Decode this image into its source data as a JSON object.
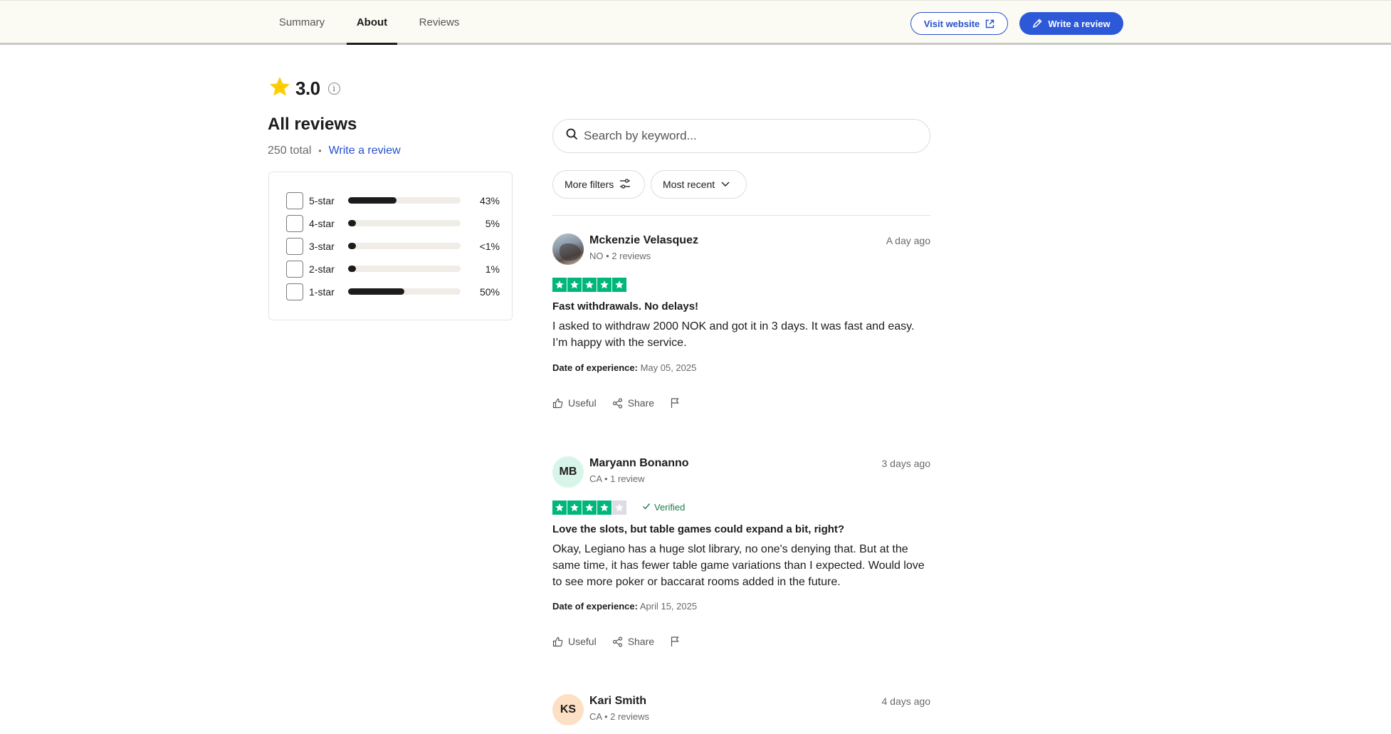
{
  "nav": {
    "tabs": [
      {
        "label": "Summary",
        "active": false
      },
      {
        "label": "About",
        "active": true
      },
      {
        "label": "Reviews",
        "active": false
      }
    ],
    "visit_label": "Visit website",
    "write_label": "Write a review"
  },
  "summary": {
    "rating": "3.0",
    "heading": "All reviews",
    "total": "250 total",
    "separator": "•",
    "write_link": "Write a review",
    "distribution": [
      {
        "label": "5-star",
        "percent": "43%",
        "fill": 0.43
      },
      {
        "label": "4-star",
        "percent": "5%",
        "fill": 0.05
      },
      {
        "label": "3-star",
        "percent": "<1%",
        "fill": 0.01
      },
      {
        "label": "2-star",
        "percent": "1%",
        "fill": 0.01
      },
      {
        "label": "1-star",
        "percent": "50%",
        "fill": 0.5
      }
    ]
  },
  "search": {
    "placeholder": "Search by keyword..."
  },
  "filters": {
    "more_label": "More filters",
    "sort_label": "Most recent"
  },
  "reviews": [
    {
      "name": "Mckenzie Velasquez",
      "meta": "NO • 2 reviews",
      "time": "A day ago",
      "stars": 5,
      "verified": "",
      "title": "Fast withdrawals. No delays!",
      "body": "I asked to withdraw 2000 NOK and got it in 3 days. It was fast and easy. I’m happy with the service.",
      "experience_label": "Date of experience:",
      "experience_date": "May 05, 2025"
    },
    {
      "name": "Maryann Bonanno",
      "initials": "MB",
      "meta": "CA • 1 review",
      "time": "3 days ago",
      "stars": 4,
      "verified": "Verified",
      "title": "Love the slots, but table games could expand a bit, right?",
      "body": "Okay, Legiano has a huge slot library, no one's denying that. But at the same time, it has fewer table game variations than I expected. Would love to see more poker or baccarat rooms added in the future.",
      "experience_label": "Date of experience:",
      "experience_date": "April 15, 2025"
    },
    {
      "name": "Kari Smith",
      "initials": "KS",
      "meta": "CA • 2 reviews",
      "time": "4 days ago"
    }
  ],
  "actions": {
    "useful": "Useful",
    "share": "Share"
  },
  "colors": {
    "accent": "#2d58d8",
    "star_green": "#00b67a",
    "rating_star": "#ffcc00"
  },
  "icons": [
    "external-link-icon",
    "pencil-icon",
    "star-icon",
    "info-icon",
    "search-icon",
    "filter-sliders-icon",
    "chevron-down-icon",
    "thumbs-up-icon",
    "share-icon",
    "flag-icon",
    "check-icon"
  ]
}
